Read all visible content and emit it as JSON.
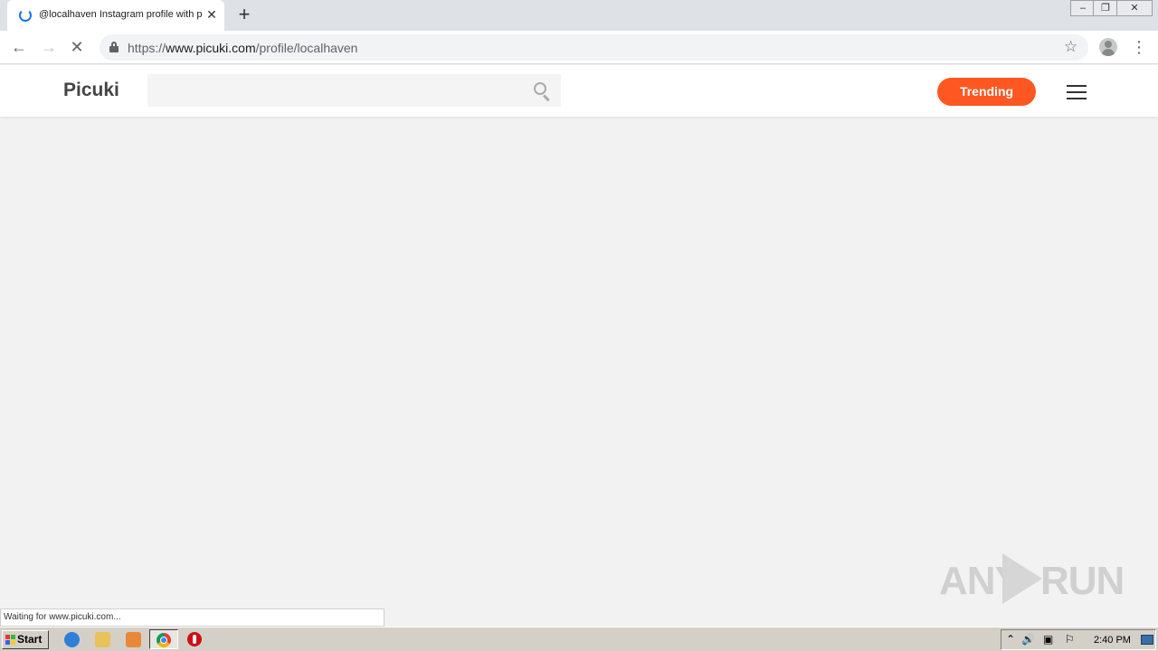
{
  "browser": {
    "tab": {
      "title": "@localhaven Instagram profile with p",
      "close_label": "✕"
    },
    "new_tab_label": "+",
    "window_controls": {
      "minimize": "–",
      "restore": "❐",
      "close": "✕"
    },
    "nav": {
      "back": "←",
      "forward": "→",
      "stop": "✕"
    },
    "address": {
      "scheme": "https://",
      "host": "www.picuki.com",
      "path": "/profile/localhaven"
    },
    "bookmark_star": "☆",
    "menu_label": "⋮"
  },
  "site": {
    "logo": "Picuki",
    "search": {
      "value": "",
      "placeholder": ""
    },
    "trending_label": "Trending",
    "colors": {
      "accent": "#ff5722",
      "page_bg": "#f2f2f2"
    }
  },
  "status": {
    "text": "Waiting for www.picuki.com..."
  },
  "watermark": {
    "left": "ANY",
    "right": "RUN"
  },
  "taskbar": {
    "start_label": "Start",
    "tray": {
      "show_hidden": "⌃",
      "volume": "🔊",
      "network": "▣",
      "flag": "⚐"
    },
    "clock": "2:40 PM"
  }
}
